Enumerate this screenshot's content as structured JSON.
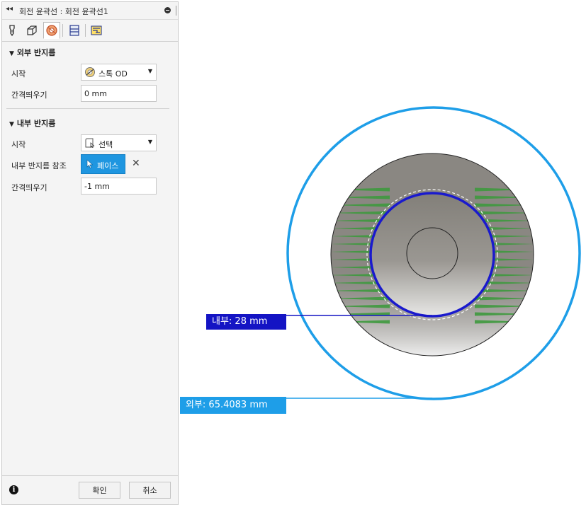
{
  "panel": {
    "title": "회전 윤곽선 : 회전 윤곽선1",
    "collapse_glyph": "◂◂",
    "tabs": [
      {
        "name": "tool-icon"
      },
      {
        "name": "geometry-icon"
      },
      {
        "name": "radii-icon",
        "active": true
      },
      {
        "name": "passes-icon"
      },
      {
        "name": "linking-icon"
      }
    ],
    "outer_section": {
      "heading": "외부 반지름",
      "start_label": "시작",
      "start_value": "스톡 OD",
      "offset_label": "간격띄우기",
      "offset_value": "0 mm"
    },
    "inner_section": {
      "heading": "내부 반지름",
      "start_label": "시작",
      "start_value": "선택",
      "ref_label": "내부 반지름 참조",
      "ref_button": "페이스",
      "offset_label": "간격띄우기",
      "offset_value": "-1 mm"
    },
    "footer": {
      "info": "i",
      "ok": "확인",
      "cancel": "취소"
    }
  },
  "viewport": {
    "inner_label": "내부: 28 mm",
    "outer_label": "외부: 65.4083 mm",
    "colors": {
      "inner_ring": "#1a1acd",
      "outer_ring": "#1e9ee8",
      "inner_tag_bg": "#1414c4",
      "outer_tag_bg": "#1e9ee8",
      "stock_gray": "#8a8782",
      "toolpath_green": "#3f9a3f"
    }
  }
}
